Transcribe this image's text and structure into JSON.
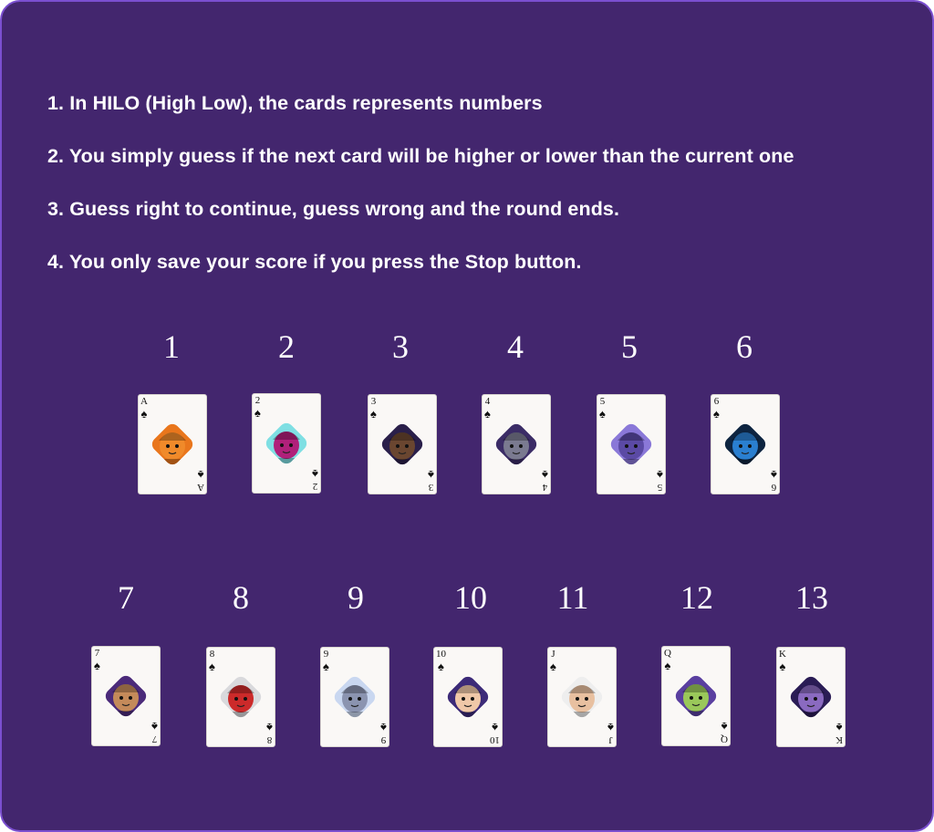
{
  "rules": [
    "1. In HILO (High Low), the cards represents numbers",
    "2. You simply guess if the next card will be higher or lower than the current one",
    "3. Guess right to continue, guess wrong and the round ends.",
    "4. You only save your score if you press the Stop button."
  ],
  "cards": [
    {
      "value": "1",
      "rank": "A",
      "suit": "♠",
      "avatar": "orange-bull-avatar",
      "bg": "#e9761c",
      "face": "#f08a2a"
    },
    {
      "value": "2",
      "rank": "2",
      "suit": "♠",
      "avatar": "magenta-dog-avatar",
      "bg": "#7fdfe3",
      "face": "#b0207a"
    },
    {
      "value": "3",
      "rank": "3",
      "suit": "♠",
      "avatar": "brown-beaver-avatar",
      "bg": "#2a1f4a",
      "face": "#6a4630"
    },
    {
      "value": "4",
      "rank": "4",
      "suit": "♠",
      "avatar": "gray-hippo-avatar",
      "bg": "#3b2c66",
      "face": "#7a7a90"
    },
    {
      "value": "5",
      "rank": "5",
      "suit": "♠",
      "avatar": "purple-beaver-avatar",
      "bg": "#8a78d8",
      "face": "#5b4aa5"
    },
    {
      "value": "6",
      "rank": "6",
      "suit": "♠",
      "avatar": "blue-circuit-avatar",
      "bg": "#0d2440",
      "face": "#2a7fd0"
    },
    {
      "value": "7",
      "rank": "7",
      "suit": "♠",
      "avatar": "hooded-kid-avatar",
      "bg": "#4b2a7a",
      "face": "#c48a5a"
    },
    {
      "value": "8",
      "rank": "8",
      "suit": "♠",
      "avatar": "red-cap-3d-glasses-avatar",
      "bg": "#d9d9dc",
      "face": "#cc2a2a"
    },
    {
      "value": "9",
      "rank": "9",
      "suit": "♠",
      "avatar": "pixel-helmet-avatar",
      "bg": "#c9d7f0",
      "face": "#8b94b0"
    },
    {
      "value": "10",
      "rank": "10",
      "suit": "♠",
      "avatar": "glasses-man-avatar",
      "bg": "#3c2a78",
      "face": "#f0c8a8"
    },
    {
      "value": "11",
      "rank": "J",
      "suit": "♠",
      "avatar": "suited-man-avatar",
      "bg": "#eeeeee",
      "face": "#e8c0a0"
    },
    {
      "value": "12",
      "rank": "Q",
      "suit": "♠",
      "avatar": "green-face-hat-avatar",
      "bg": "#5a3fa0",
      "face": "#9ac85a"
    },
    {
      "value": "13",
      "rank": "K",
      "suit": "♠",
      "avatar": "glasses-woman-avatar",
      "bg": "#2a1c55",
      "face": "#8a6ac0"
    }
  ]
}
